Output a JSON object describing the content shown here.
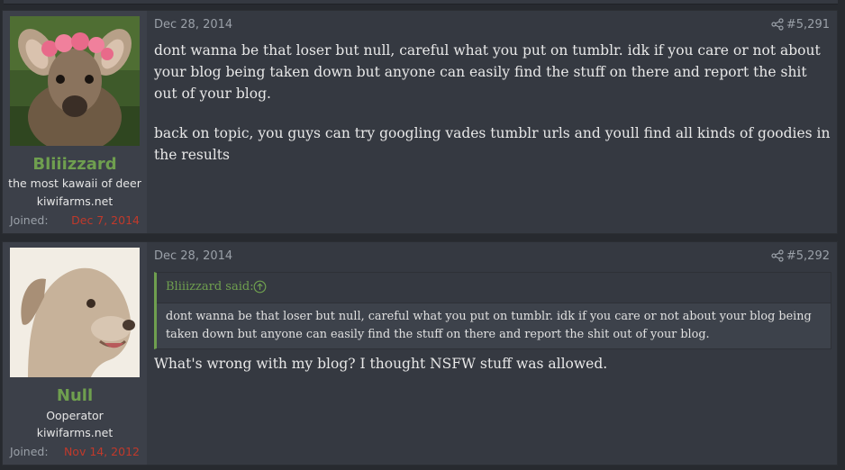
{
  "posts": [
    {
      "username": "Bliiizzard",
      "user_title": "the most kawaii of deer",
      "user_site": "kiwifarms.net",
      "joined_label": "Joined:",
      "joined_date": "Dec 7, 2014",
      "date": "Dec 28, 2014",
      "post_number": "#5,291",
      "paragraphs": [
        "dont wanna be that loser but null, careful what you put on tumblr. idk if you care or not about your blog being taken down but anyone can easily find the stuff on there and report the shit out of your blog.",
        "back on topic, you guys can try googling vades tumblr urls and youll find all kinds of goodies in the results"
      ],
      "avatar": "deer-with-flower-crown"
    },
    {
      "username": "Null",
      "user_title": "Ooperator",
      "user_site": "kiwifarms.net",
      "joined_label": "Joined:",
      "joined_date": "Nov 14, 2012",
      "date": "Dec 28, 2014",
      "post_number": "#5,292",
      "quote": {
        "author": "Bliiizzard said:",
        "text": "dont wanna be that loser but null, careful what you put on tumblr. idk if you care or not about your blog being taken down but anyone can easily find the stuff on there and report the shit out of your blog."
      },
      "reply": "What's wrong with my blog? I thought NSFW stuff was allowed.",
      "avatar": "cartoon-dog"
    }
  ],
  "icons": {
    "share": "share-icon",
    "quote_jump": "arrow-up-circle-icon"
  },
  "colors": {
    "username": "#6f9f4f",
    "joined_date": "#c0392b",
    "background": "#272a2f",
    "post_bg": "#353941"
  }
}
